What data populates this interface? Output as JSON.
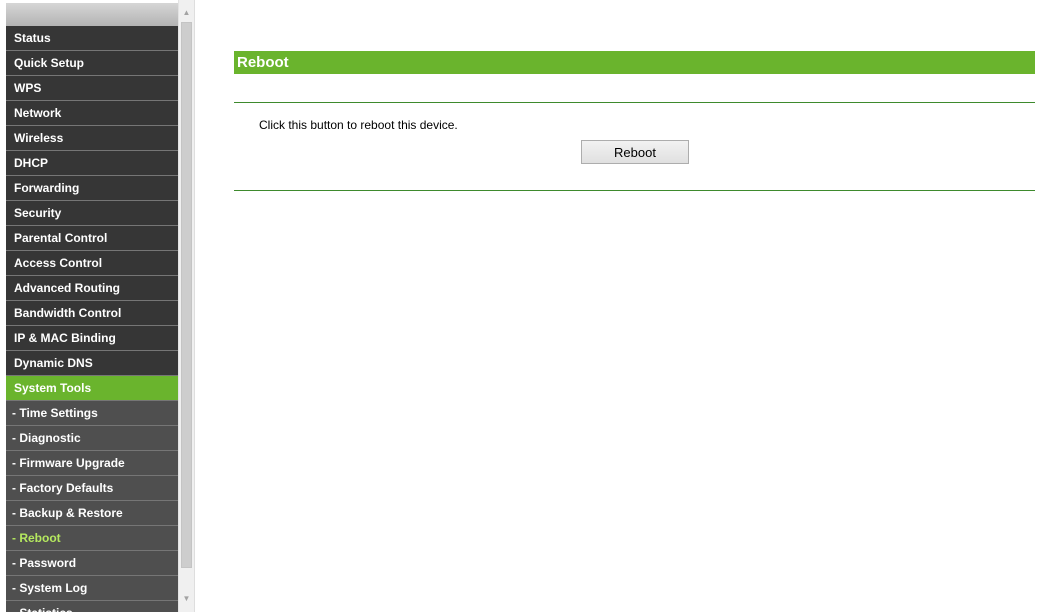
{
  "menu": {
    "items": [
      {
        "label": "Status",
        "level": "top",
        "state": "normal"
      },
      {
        "label": "Quick Setup",
        "level": "top",
        "state": "normal"
      },
      {
        "label": "WPS",
        "level": "top",
        "state": "normal"
      },
      {
        "label": "Network",
        "level": "top",
        "state": "normal"
      },
      {
        "label": "Wireless",
        "level": "top",
        "state": "normal"
      },
      {
        "label": "DHCP",
        "level": "top",
        "state": "normal"
      },
      {
        "label": "Forwarding",
        "level": "top",
        "state": "normal"
      },
      {
        "label": "Security",
        "level": "top",
        "state": "normal"
      },
      {
        "label": "Parental Control",
        "level": "top",
        "state": "normal"
      },
      {
        "label": "Access Control",
        "level": "top",
        "state": "normal"
      },
      {
        "label": "Advanced Routing",
        "level": "top",
        "state": "normal"
      },
      {
        "label": "Bandwidth Control",
        "level": "top",
        "state": "normal"
      },
      {
        "label": "IP & MAC Binding",
        "level": "top",
        "state": "normal"
      },
      {
        "label": "Dynamic DNS",
        "level": "top",
        "state": "normal"
      },
      {
        "label": "System Tools",
        "level": "top",
        "state": "active"
      },
      {
        "label": "- Time Settings",
        "level": "sub",
        "state": "normal"
      },
      {
        "label": "- Diagnostic",
        "level": "sub",
        "state": "normal"
      },
      {
        "label": "- Firmware Upgrade",
        "level": "sub",
        "state": "normal"
      },
      {
        "label": "- Factory Defaults",
        "level": "sub",
        "state": "normal"
      },
      {
        "label": "- Backup & Restore",
        "level": "sub",
        "state": "normal"
      },
      {
        "label": "- Reboot",
        "level": "sub",
        "state": "current"
      },
      {
        "label": "- Password",
        "level": "sub",
        "state": "normal"
      },
      {
        "label": "- System Log",
        "level": "sub",
        "state": "normal"
      },
      {
        "label": "- Statistics",
        "level": "sub",
        "state": "cut"
      }
    ]
  },
  "scrollbar": {
    "up_icon": "▲",
    "down_icon": "▼"
  },
  "page": {
    "title": "Reboot",
    "description": "Click this button to reboot this device.",
    "button_label": "Reboot"
  },
  "colors": {
    "accent_green": "#6ab42d",
    "menu_dark": "#363636",
    "submenu_gray": "#4f4f4f",
    "current_text": "#b5e85f",
    "rule_green": "#3e8a2d"
  }
}
